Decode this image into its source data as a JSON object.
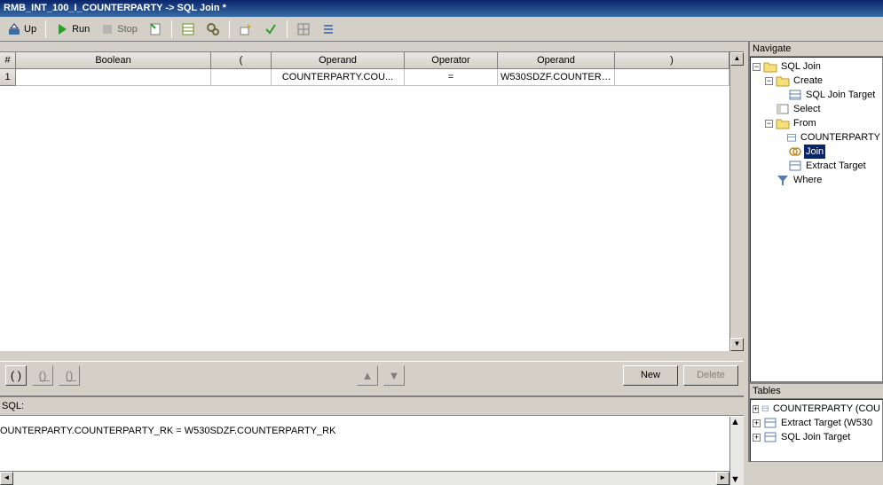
{
  "title": "RMB_INT_100_I_COUNTERPARTY -> SQL Join *",
  "toolbar": {
    "up": "Up",
    "run": "Run",
    "stop": "Stop"
  },
  "grid": {
    "headers": {
      "num": "#",
      "boolean": "Boolean",
      "lparen": "(",
      "operand1": "Operand",
      "operator": "Operator",
      "operand2": "Operand",
      "rparen": ")"
    },
    "rows": [
      {
        "num": "1",
        "boolean": "",
        "lparen": "",
        "operand1": "COUNTERPARTY.COU...",
        "operator": "=",
        "operand2": "W530SDZF.COUNTERP...",
        "rparen": ""
      }
    ]
  },
  "buttons": {
    "parens": "( )",
    "new": "New",
    "delete": "Delete"
  },
  "sql": {
    "label": "SQL:",
    "text": "OUNTERPARTY.COUNTERPARTY_RK = W530SDZF.COUNTERPARTY_RK"
  },
  "navigate": {
    "title": "Navigate",
    "nodes": {
      "root": "SQL Join",
      "create": "Create",
      "sql_join_target": "SQL Join Target",
      "select": "Select",
      "from": "From",
      "counterparty": "COUNTERPARTY",
      "join": "Join",
      "extract_target": "Extract Target",
      "where": "Where"
    }
  },
  "tables": {
    "title": "Tables",
    "items": [
      "COUNTERPARTY (COU",
      "Extract Target (W530",
      "SQL Join Target"
    ]
  },
  "icons": {
    "folder": "📁",
    "folder_open": "📂",
    "table": "▦",
    "join": "⊕",
    "target": "▦",
    "where": "🝖",
    "select": "▥"
  }
}
